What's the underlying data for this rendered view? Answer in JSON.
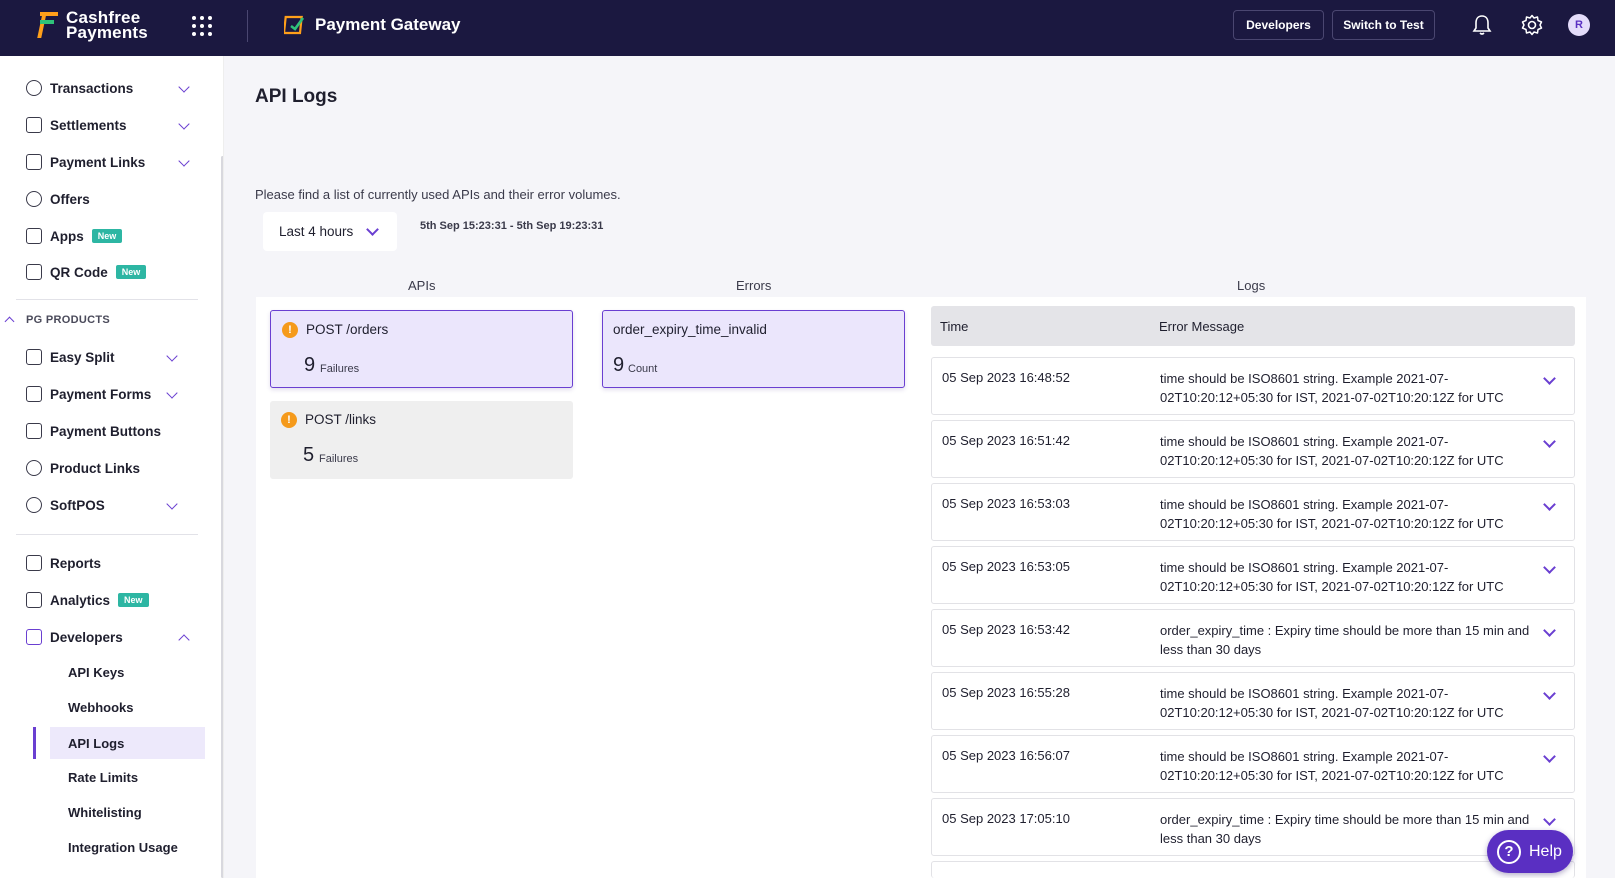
{
  "topbar": {
    "brand_line1": "Cashfree",
    "brand_line2": "Payments",
    "product": "Payment Gateway",
    "developers_btn": "Developers",
    "switch_btn": "Switch to Test",
    "avatar_initial": "R"
  },
  "sidebar": {
    "items": [
      {
        "label": "Transactions"
      },
      {
        "label": "Settlements"
      },
      {
        "label": "Payment Links"
      },
      {
        "label": "Offers"
      },
      {
        "label": "Apps",
        "badge": "New"
      },
      {
        "label": "QR Code",
        "badge": "New"
      }
    ],
    "section": "PG PRODUCTS",
    "products": [
      {
        "label": "Easy Split"
      },
      {
        "label": "Payment Forms"
      },
      {
        "label": "Payment Buttons"
      },
      {
        "label": "Product Links"
      },
      {
        "label": "SoftPOS"
      }
    ],
    "bottom": [
      {
        "label": "Reports"
      },
      {
        "label": "Analytics",
        "badge": "New"
      },
      {
        "label": "Developers"
      }
    ],
    "dev_sub": [
      {
        "label": "API Keys"
      },
      {
        "label": "Webhooks"
      },
      {
        "label": "API Logs"
      },
      {
        "label": "Rate Limits"
      },
      {
        "label": "Whitelisting"
      },
      {
        "label": "Integration Usage"
      }
    ]
  },
  "main": {
    "title": "API Logs",
    "description": "Please find a list of currently used APIs and their error volumes.",
    "range_select": "Last 4 hours",
    "range_text": "5th Sep 15:23:31 - 5th Sep 19:23:31",
    "col_apis": "APIs",
    "col_errors": "Errors",
    "col_logs": "Logs",
    "apis": [
      {
        "name": "POST /orders",
        "count": "9",
        "unit": "Failures"
      },
      {
        "name": "POST /links",
        "count": "5",
        "unit": "Failures"
      }
    ],
    "errors": [
      {
        "name": "order_expiry_time_invalid",
        "count": "9",
        "unit": "Count"
      }
    ],
    "logs_header": {
      "time": "Time",
      "message": "Error Message"
    },
    "logs": [
      {
        "time": "05 Sep 2023 16:48:52",
        "message": "time should be ISO8601 string. Example 2021-07-02T10:20:12+05:30 for IST, 2021-07-02T10:20:12Z for UTC"
      },
      {
        "time": "05 Sep 2023 16:51:42",
        "message": "time should be ISO8601 string. Example 2021-07-02T10:20:12+05:30 for IST, 2021-07-02T10:20:12Z for UTC"
      },
      {
        "time": "05 Sep 2023 16:53:03",
        "message": "time should be ISO8601 string. Example 2021-07-02T10:20:12+05:30 for IST, 2021-07-02T10:20:12Z for UTC"
      },
      {
        "time": "05 Sep 2023 16:53:05",
        "message": "time should be ISO8601 string. Example 2021-07-02T10:20:12+05:30 for IST, 2021-07-02T10:20:12Z for UTC"
      },
      {
        "time": "05 Sep 2023 16:53:42",
        "message": "order_expiry_time : Expiry time should be more than 15 min and less than 30 days"
      },
      {
        "time": "05 Sep 2023 16:55:28",
        "message": "time should be ISO8601 string. Example 2021-07-02T10:20:12+05:30 for IST, 2021-07-02T10:20:12Z for UTC"
      },
      {
        "time": "05 Sep 2023 16:56:07",
        "message": "time should be ISO8601 string. Example 2021-07-02T10:20:12+05:30 for IST, 2021-07-02T10:20:12Z for UTC"
      },
      {
        "time": "05 Sep 2023 17:05:10",
        "message": "order_expiry_time : Expiry time should be more than 15 min and less than 30 days"
      }
    ],
    "help": "Help"
  }
}
